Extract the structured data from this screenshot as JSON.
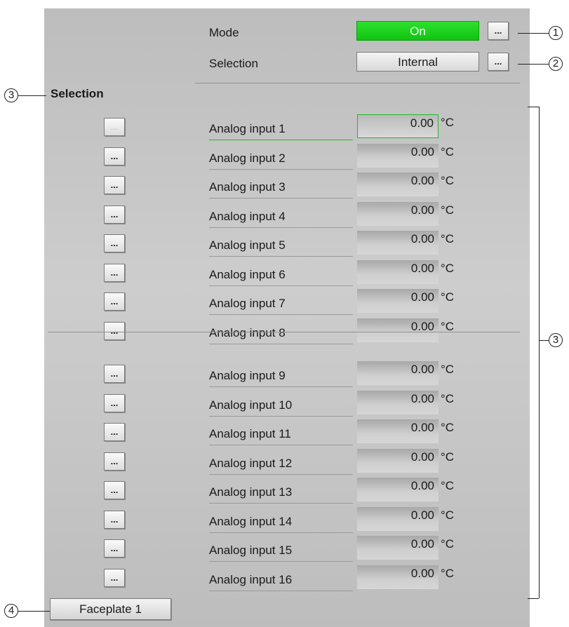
{
  "header": {
    "mode_label": "Mode",
    "mode_value": "On",
    "selection_label": "Selection",
    "selection_value": "Internal",
    "more_label": "..."
  },
  "section": {
    "title": "Selection"
  },
  "inputs": [
    {
      "name": "Analog input 1",
      "value": "0.00",
      "unit": "°C",
      "button": "...",
      "enabled": false
    },
    {
      "name": "Analog input 2",
      "value": "0.00",
      "unit": "°C",
      "button": "...",
      "enabled": true
    },
    {
      "name": "Analog input 3",
      "value": "0.00",
      "unit": "°C",
      "button": "...",
      "enabled": true
    },
    {
      "name": "Analog input 4",
      "value": "0.00",
      "unit": "°C",
      "button": "...",
      "enabled": true
    },
    {
      "name": "Analog input 5",
      "value": "0.00",
      "unit": "°C",
      "button": "...",
      "enabled": true
    },
    {
      "name": "Analog input 6",
      "value": "0.00",
      "unit": "°C",
      "button": "...",
      "enabled": true
    },
    {
      "name": "Analog input 7",
      "value": "0.00",
      "unit": "°C",
      "button": "...",
      "enabled": true
    },
    {
      "name": "Analog input 8",
      "value": "0.00",
      "unit": "°C",
      "button": "...",
      "enabled": true
    },
    {
      "name": "Analog input 9",
      "value": "0.00",
      "unit": "°C",
      "button": "...",
      "enabled": true
    },
    {
      "name": "Analog input 10",
      "value": "0.00",
      "unit": "°C",
      "button": "...",
      "enabled": true
    },
    {
      "name": "Analog input 11",
      "value": "0.00",
      "unit": "°C",
      "button": "...",
      "enabled": true
    },
    {
      "name": "Analog input 12",
      "value": "0.00",
      "unit": "°C",
      "button": "...",
      "enabled": true
    },
    {
      "name": "Analog input 13",
      "value": "0.00",
      "unit": "°C",
      "button": "...",
      "enabled": true
    },
    {
      "name": "Analog input 14",
      "value": "0.00",
      "unit": "°C",
      "button": "...",
      "enabled": true
    },
    {
      "name": "Analog input 15",
      "value": "0.00",
      "unit": "°C",
      "button": "...",
      "enabled": true
    },
    {
      "name": "Analog input 16",
      "value": "0.00",
      "unit": "°C",
      "button": "...",
      "enabled": true
    }
  ],
  "footer": {
    "faceplate_label": "Faceplate 1"
  },
  "callouts": {
    "c1": "1",
    "c2": "2",
    "c3a": "3",
    "c3b": "3",
    "c4": "4"
  },
  "colors": {
    "mode_on": "#10c410",
    "panel": "#c4c4c4",
    "focus_border": "#28b428"
  }
}
